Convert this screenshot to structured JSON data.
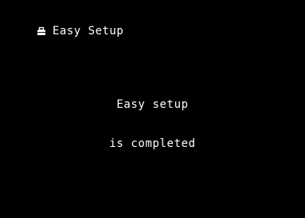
{
  "header": {
    "icon": "toolbox-icon",
    "title": "Easy Setup"
  },
  "message": {
    "line1": "Easy setup",
    "line2": "is completed"
  },
  "colors": {
    "background": "#000000",
    "text": "#ffffff"
  }
}
